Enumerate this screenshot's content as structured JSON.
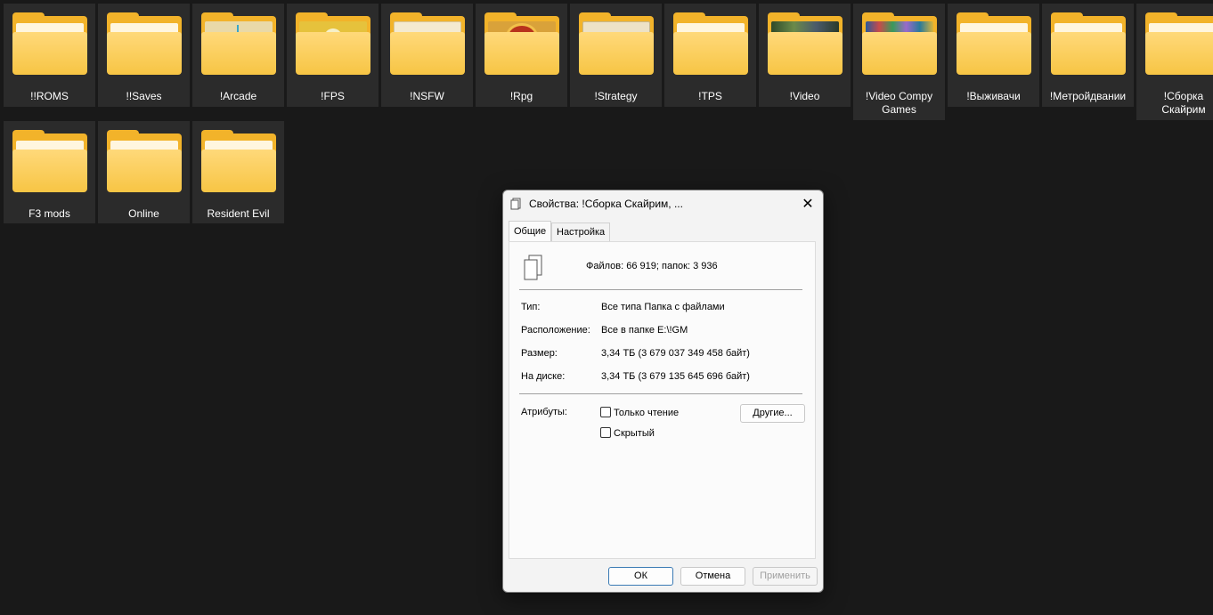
{
  "folders": [
    {
      "label": "!!ROMS"
    },
    {
      "label": "!!Saves"
    },
    {
      "label": "!Arcade"
    },
    {
      "label": "!FPS"
    },
    {
      "label": "!NSFW"
    },
    {
      "label": "!Rpg"
    },
    {
      "label": "!Strategy"
    },
    {
      "label": "!TPS"
    },
    {
      "label": "!Video"
    },
    {
      "label": "!Video Compy\nGames"
    },
    {
      "label": "!Выживачи"
    },
    {
      "label": "!Метройдвании"
    },
    {
      "label": "!Сборка\nСкайрим"
    },
    {
      "label": "F3 mods"
    },
    {
      "label": "Online"
    },
    {
      "label": "Resident Evil"
    }
  ],
  "dialog": {
    "title": "Свойства: !Сборка Скайрим, ...",
    "tabs": [
      "Общие",
      "Настройка"
    ],
    "summary": "Файлов: 66 919; папок: 3 936",
    "type_label": "Тип:",
    "type_value": "Все типа Папка с файлами",
    "location_label": "Расположение:",
    "location_value": "Все в папке E:\\!GM",
    "size_label": "Размер:",
    "size_value": "3,34 ТБ (3 679 037 349 458 байт)",
    "disk_label": "На диске:",
    "disk_value": "3,34 ТБ (3 679 135 645 696 байт)",
    "attributes_label": "Атрибуты:",
    "readonly_label": "Только чтение",
    "hidden_label": "Скрытый",
    "other_button": "Другие...",
    "ok_button": "ОК",
    "cancel_button": "Отмена",
    "apply_button": "Применить"
  },
  "colors": {
    "folder": "#f2b32a",
    "tile_bg": "#2b2b2b",
    "desktop_bg": "#191919"
  }
}
